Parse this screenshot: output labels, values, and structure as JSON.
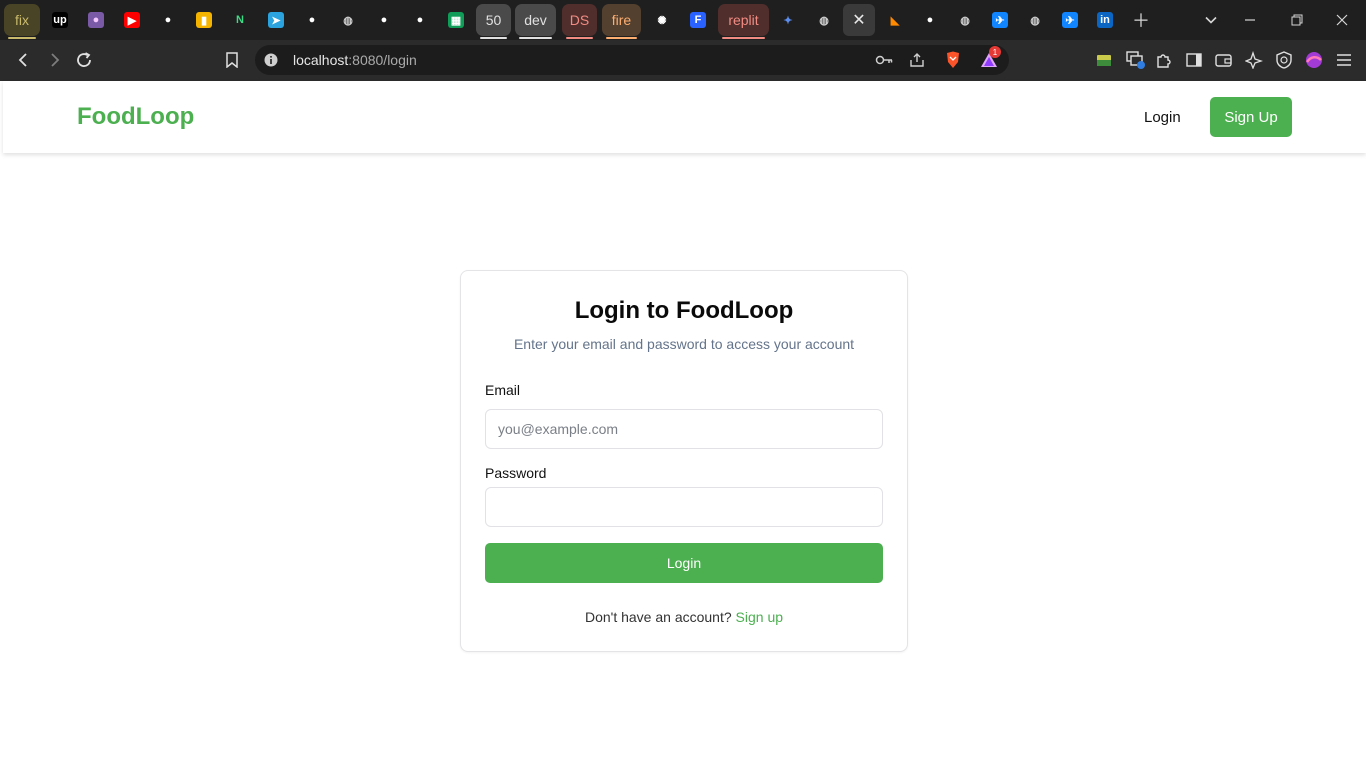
{
  "browser": {
    "tabs": [
      {
        "name": "tab-group-fix",
        "type": "group",
        "label": "fix",
        "color": "#c9b96b",
        "bg": "#4a4426"
      },
      {
        "name": "tab-upwork",
        "icon": "upwork-icon",
        "glyph": "up",
        "bg": "#000000",
        "color": "#ffffff"
      },
      {
        "name": "tab-avatar",
        "icon": "avatar-icon",
        "glyph": "●",
        "bg": "#7a5aa6",
        "color": "#f3c9ff"
      },
      {
        "name": "tab-youtube",
        "icon": "youtube-icon",
        "glyph": "▶",
        "bg": "#ff0000",
        "color": "#ffffff"
      },
      {
        "name": "tab-github-1",
        "icon": "github-icon",
        "glyph": "●",
        "bg": "#1f1f1f",
        "color": "#ffffff"
      },
      {
        "name": "tab-keep",
        "icon": "keep-icon",
        "glyph": "▮",
        "bg": "#f4b400",
        "color": "#ffffff"
      },
      {
        "name": "tab-neetcode",
        "icon": "neetcode-icon",
        "glyph": "N",
        "bg": "#1f1f1f",
        "color": "#3ddc84"
      },
      {
        "name": "tab-telegram",
        "icon": "telegram-icon",
        "glyph": "➤",
        "bg": "#2aa3de",
        "color": "#ffffff"
      },
      {
        "name": "tab-github-2",
        "icon": "github-icon",
        "glyph": "●",
        "bg": "#1f1f1f",
        "color": "#ffffff"
      },
      {
        "name": "tab-globe-1",
        "icon": "globe-icon",
        "glyph": "◍",
        "bg": "#1f1f1f",
        "color": "#cfcfcf"
      },
      {
        "name": "tab-github-3",
        "icon": "github-icon",
        "glyph": "●",
        "bg": "#1f1f1f",
        "color": "#ffffff"
      },
      {
        "name": "tab-github-4",
        "icon": "github-icon",
        "glyph": "●",
        "bg": "#1f1f1f",
        "color": "#ffffff"
      },
      {
        "name": "tab-sheets",
        "icon": "sheets-icon",
        "glyph": "▦",
        "bg": "#0f9d58",
        "color": "#ffffff"
      },
      {
        "name": "tab-group-50",
        "type": "group",
        "label": "50",
        "color": "#e0e0e0",
        "bg": "#4a4a4a"
      },
      {
        "name": "tab-group-dev",
        "type": "group",
        "label": "dev",
        "color": "#e0e0e0",
        "bg": "#4a4a4a"
      },
      {
        "name": "tab-group-ds",
        "type": "group",
        "label": "DS",
        "color": "#f28b82",
        "bg": "#4f2e2c"
      },
      {
        "name": "tab-group-fire",
        "type": "group",
        "label": "fire",
        "color": "#fcad70",
        "bg": "#54402e"
      },
      {
        "name": "tab-openai",
        "icon": "openai-icon",
        "glyph": "✺",
        "bg": "#1f1f1f",
        "color": "#ffffff"
      },
      {
        "name": "tab-framer",
        "icon": "framer-icon",
        "glyph": "F",
        "bg": "#2962ff",
        "color": "#ffffff"
      },
      {
        "name": "tab-group-replit",
        "type": "group",
        "label": "replit",
        "color": "#f28b82",
        "bg": "#4f2e2c"
      },
      {
        "name": "tab-gemini",
        "icon": "gemini-icon",
        "glyph": "✦",
        "bg": "#1f1f1f",
        "color": "#5b8def"
      },
      {
        "name": "tab-globe-2",
        "icon": "globe-icon",
        "glyph": "◍",
        "bg": "#1f1f1f",
        "color": "#cfcfcf"
      },
      {
        "name": "tab-active",
        "type": "active",
        "icon": "close-icon",
        "glyph": "✕"
      },
      {
        "name": "tab-firebase",
        "icon": "firebase-icon",
        "glyph": "◣",
        "bg": "#1f1f1f",
        "color": "#ff8a00"
      },
      {
        "name": "tab-github-5",
        "icon": "github-icon",
        "glyph": "●",
        "bg": "#1f1f1f",
        "color": "#ffffff"
      },
      {
        "name": "tab-globe-3",
        "icon": "globe-icon",
        "glyph": "◍",
        "bg": "#1f1f1f",
        "color": "#cfcfcf"
      },
      {
        "name": "tab-bluesky-1",
        "icon": "bluesky-icon",
        "glyph": "✈",
        "bg": "#1185fe",
        "color": "#ffffff"
      },
      {
        "name": "tab-globe-4",
        "icon": "globe-icon",
        "glyph": "◍",
        "bg": "#1f1f1f",
        "color": "#cfcfcf"
      },
      {
        "name": "tab-bluesky-2",
        "icon": "bluesky-icon",
        "glyph": "✈",
        "bg": "#1185fe",
        "color": "#ffffff"
      },
      {
        "name": "tab-linkedin",
        "icon": "linkedin-icon",
        "glyph": "in",
        "bg": "#0a66c2",
        "color": "#ffffff"
      }
    ],
    "url_host": "localhost",
    "url_rest": ":8080/login",
    "notification_count": "1",
    "accent_color": "#4caf50"
  },
  "nav": {
    "brand": "FoodLoop",
    "login_label": "Login",
    "signup_label": "Sign Up"
  },
  "card": {
    "title": "Login to FoodLoop",
    "subtitle": "Enter your email and password to access your account",
    "email_label": "Email",
    "email_placeholder": "you@example.com",
    "password_label": "Password",
    "password_placeholder": "",
    "submit_label": "Login",
    "footer_text": "Don't have an account?",
    "footer_link": "Sign up"
  }
}
